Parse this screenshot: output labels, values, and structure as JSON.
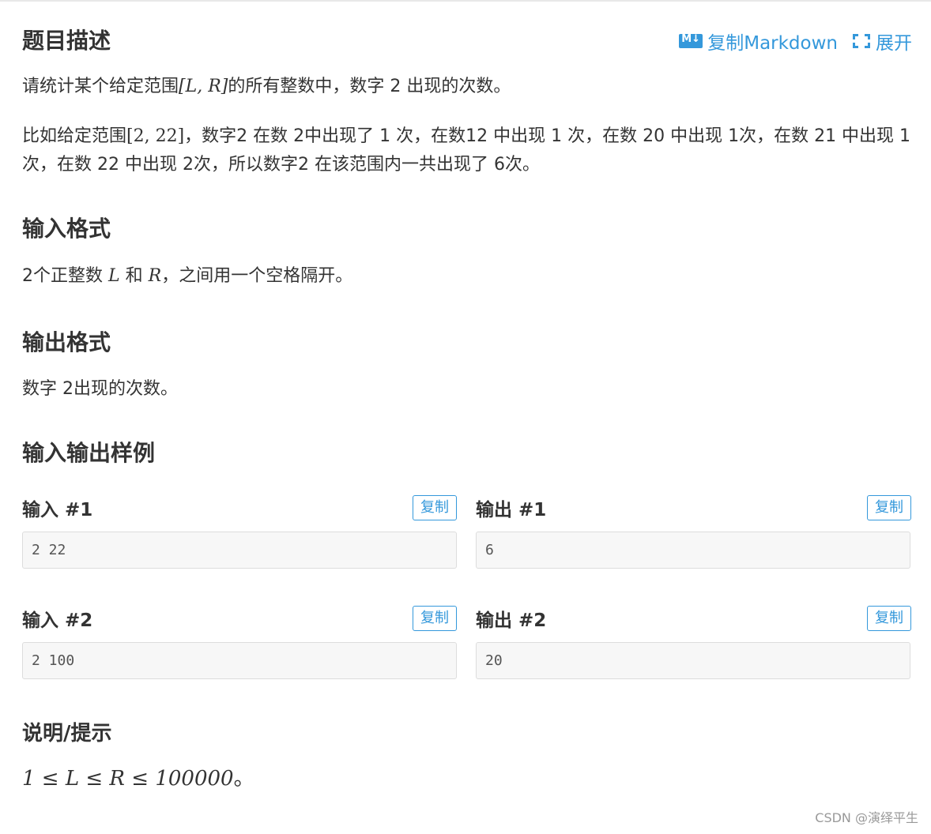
{
  "header": {
    "title": "题目描述",
    "copy_markdown": "复制Markdown",
    "expand": "展开"
  },
  "description": {
    "p1_a": "请统计某个给定范围",
    "p1_math": "[L, R]",
    "p1_b": "的所有整数中，数字 2 出现的次数。",
    "p2_a": "比如给定范围",
    "p2_math": "[2, 22]",
    "p2_b": "，数字2 在数 2中出现了 1 次，在数12 中出现 1 次，在数 20 中出现 1次，在数 21 中出现 1 次，在数 22 中出现 2次，所以数字2 在该范围内一共出现了 6次。"
  },
  "input_format": {
    "title": "输入格式",
    "a": "2个正整数 ",
    "L": "L",
    "b": " 和 ",
    "R": "R",
    "c": "，之间用一个空格隔开。"
  },
  "output_format": {
    "title": "输出格式",
    "text": "数字 2出现的次数。"
  },
  "samples": {
    "title": "输入输出样例",
    "copy_label": "复制",
    "items": [
      {
        "in_label": "输入 #1",
        "in_value": "2 22",
        "out_label": "输出 #1",
        "out_value": "6"
      },
      {
        "in_label": "输入 #2",
        "in_value": "2 100",
        "out_label": "输出 #2",
        "out_value": "20"
      }
    ]
  },
  "hint": {
    "title": "说明/提示",
    "math": "1 ≤ L ≤ R ≤ 100000",
    "tail": "。"
  },
  "watermark": "CSDN @演绎平生",
  "colors": {
    "accent": "#3498db",
    "text": "#333333",
    "box_bg": "#f7f7f7",
    "box_border": "#dddddd"
  }
}
